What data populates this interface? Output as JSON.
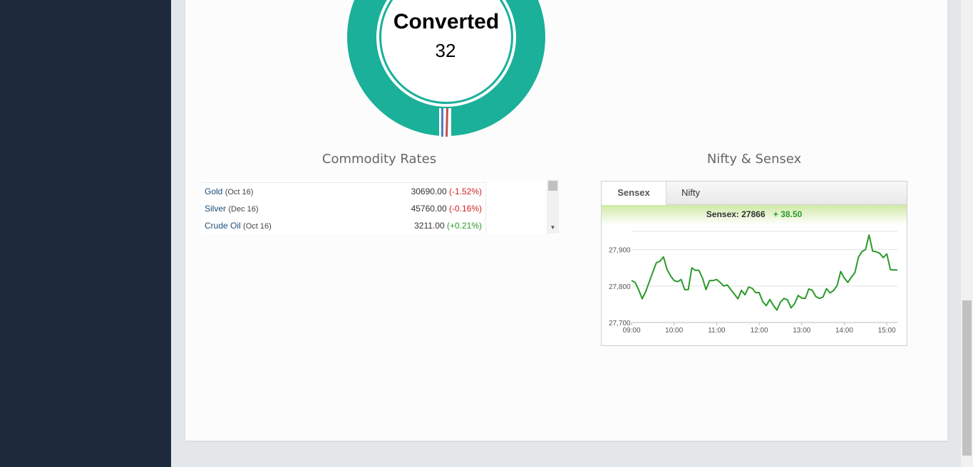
{
  "donut": {
    "title": "Converted",
    "value": "32",
    "colors": {
      "main": "#1ab09a",
      "blue": "#4a7fc4",
      "red": "#c0504d"
    }
  },
  "commodity": {
    "title": "Commodity Rates",
    "rows": [
      {
        "name": "Gold",
        "date": "(Oct 16)",
        "price": "30690.00",
        "change": "(-1.52%)",
        "direction": "down"
      },
      {
        "name": "Silver",
        "date": "(Dec 16)",
        "price": "45760.00",
        "change": "(-0.16%)",
        "direction": "down"
      },
      {
        "name": "Crude Oil",
        "date": "(Oct 16)",
        "price": "3211.00",
        "change": "(+0.21%)",
        "direction": "up"
      }
    ]
  },
  "nifty": {
    "title": "Nifty & Sensex",
    "tabs": [
      "Sensex",
      "Nifty"
    ],
    "active_tab": "Sensex",
    "quote_label": "Sensex: 27866",
    "quote_change": "+ 38.50"
  },
  "chart_data": {
    "type": "line",
    "series": [
      {
        "x": [
          "09:00",
          "09:05",
          "09:10",
          "09:15",
          "09:20",
          "09:25",
          "09:30",
          "09:35",
          "09:40",
          "09:45",
          "09:50",
          "09:55",
          "10:00",
          "10:05",
          "10:10",
          "10:15",
          "10:20",
          "10:25",
          "10:30",
          "10:35",
          "10:40",
          "10:45",
          "10:50",
          "10:55",
          "11:00",
          "11:05",
          "11:10",
          "11:15",
          "11:20",
          "11:25",
          "11:30",
          "11:35",
          "11:40",
          "11:45",
          "11:50",
          "11:55",
          "12:00",
          "12:05",
          "12:10",
          "12:15",
          "12:20",
          "12:25",
          "12:30",
          "12:35",
          "12:40",
          "12:45",
          "12:50",
          "12:55",
          "13:00",
          "13:05",
          "13:10",
          "13:15",
          "13:20",
          "13:25",
          "13:30",
          "13:35",
          "13:40",
          "13:45",
          "13:50",
          "13:55",
          "14:00",
          "14:05",
          "14:10",
          "14:15",
          "14:20",
          "14:25",
          "14:30",
          "14:35",
          "14:40",
          "14:45",
          "14:50",
          "14:55",
          "15:00",
          "15:05",
          "15:10",
          "15:15"
        ],
        "values": [
          27815,
          27810,
          27790,
          27765,
          27785,
          27812,
          27838,
          27864,
          27868,
          27880,
          27846,
          27828,
          27815,
          27812,
          27818,
          27790,
          27790,
          27850,
          27843,
          27843,
          27822,
          27790,
          27815,
          27815,
          27818,
          27810,
          27800,
          27803,
          27790,
          27778,
          27765,
          27788,
          27776,
          27797,
          27794,
          27782,
          27782,
          27757,
          27746,
          27763,
          27747,
          27734,
          27756,
          27766,
          27762,
          27740,
          27752,
          27774,
          27767,
          27766,
          27792,
          27788,
          27771,
          27766,
          27770,
          27793,
          27781,
          27788,
          27802,
          27840,
          27822,
          27810,
          27824,
          27837,
          27879,
          27895,
          27900,
          27940,
          27896,
          27894,
          27890,
          27878,
          27888,
          27845,
          27844,
          27844
        ],
        "color": "#2a9a2a"
      }
    ],
    "x_ticks": [
      "09:00",
      "10:00",
      "11:00",
      "12:00",
      "13:00",
      "14:00",
      "15:00"
    ],
    "y_ticks": [
      "27,700",
      "27,800",
      "27,900"
    ],
    "ylim": [
      27700,
      27950
    ],
    "grid": true
  }
}
